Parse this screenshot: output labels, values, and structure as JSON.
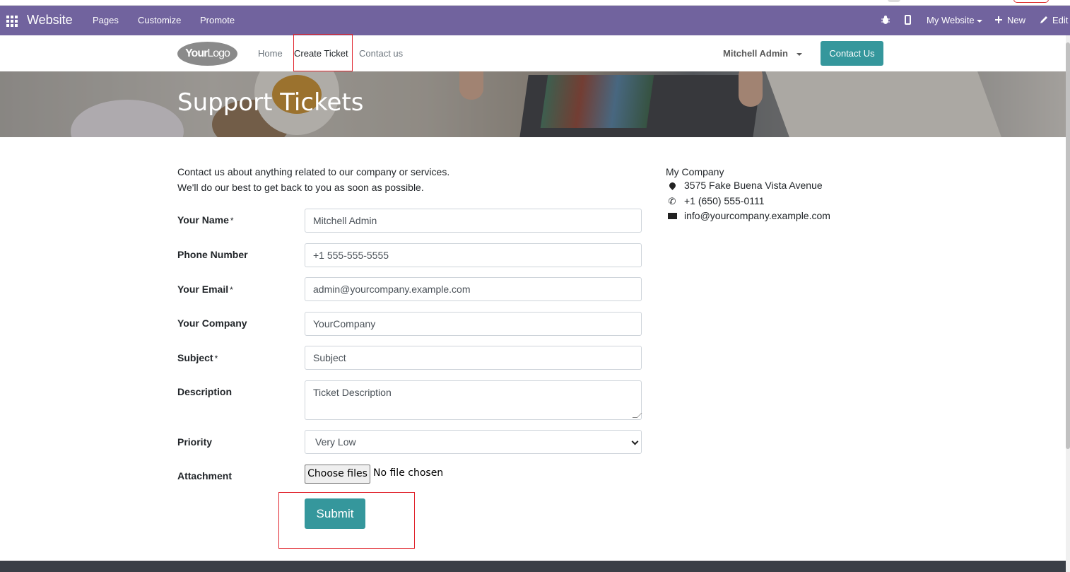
{
  "admin_bar": {
    "app_name": "Website",
    "menu": [
      "Pages",
      "Customize",
      "Promote"
    ],
    "my_website": "My Website",
    "new": "New",
    "edit": "Edit"
  },
  "site_nav": {
    "logo_bold": "Your",
    "logo_light": "Logo",
    "links": [
      "Home",
      "Create Ticket",
      "Contact us"
    ],
    "user": "Mitchell Admin",
    "contact_button": "Contact Us"
  },
  "banner": {
    "title": "Support Tickets"
  },
  "intro": {
    "line1": "Contact us about anything related to our company or services.",
    "line2": "We'll do our best to get back to you as soon as possible."
  },
  "form": {
    "name_label": "Your Name",
    "name_value": "Mitchell Admin",
    "phone_label": "Phone Number",
    "phone_value": "+1 555-555-5555",
    "email_label": "Your Email",
    "email_value": "admin@yourcompany.example.com",
    "company_label": "Your Company",
    "company_value": "YourCompany",
    "subject_label": "Subject",
    "subject_placeholder": "Subject",
    "description_label": "Description",
    "description_placeholder": "Ticket Description",
    "priority_label": "Priority",
    "priority_value": "Very Low",
    "attachment_label": "Attachment",
    "choose_files": "Choose files",
    "no_file": "No file chosen",
    "submit": "Submit",
    "required_mark": "*"
  },
  "company_info": {
    "name": "My Company",
    "address": "3575 Fake Buena Vista Avenue",
    "phone": "+1 (650) 555-0111",
    "email": "info@yourcompany.example.com"
  },
  "colors": {
    "admin_bar": "#71639e",
    "accent": "#35979c",
    "highlight_box": "#e0242d"
  }
}
